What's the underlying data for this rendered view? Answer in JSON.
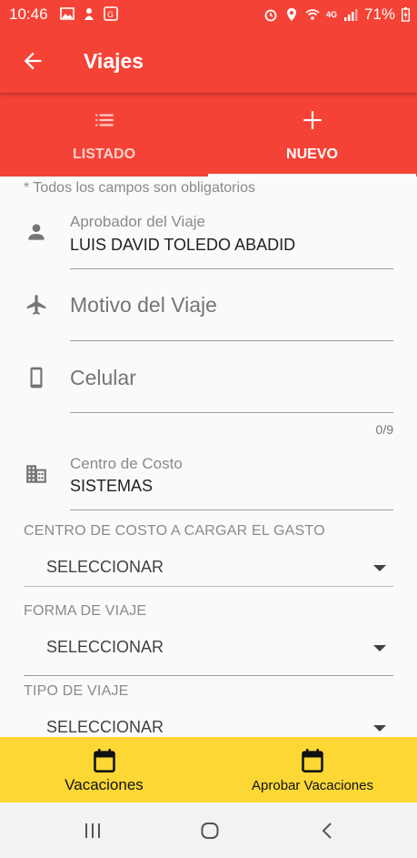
{
  "status_bar": {
    "time": "10:46",
    "battery": "71%",
    "network": "4G"
  },
  "app_bar": {
    "title": "Viajes",
    "back_icon": "arrow-back-icon"
  },
  "tabs": [
    {
      "label": "LISTADO",
      "icon": "list-icon",
      "active": false
    },
    {
      "label": "NUEVO",
      "icon": "plus-icon",
      "active": true
    }
  ],
  "form": {
    "required_note": "* Todos los campos son obligatorios",
    "approver": {
      "label": "Aprobador del Viaje",
      "value": "LUIS DAVID TOLEDO ABADID",
      "icon": "person-icon"
    },
    "reason": {
      "placeholder": "Motivo del Viaje",
      "icon": "airplane-icon"
    },
    "phone": {
      "placeholder": "Celular",
      "icon": "phone-icon",
      "counter": "0/9"
    },
    "cost_center": {
      "label": "Centro de Costo",
      "value": "SISTEMAS",
      "icon": "building-icon"
    },
    "charge_cost_center": {
      "label": "CENTRO DE COSTO A CARGAR EL GASTO",
      "value": "SELECCIONAR"
    },
    "travel_mode": {
      "label": "FORMA DE VIAJE",
      "value": "SELECCIONAR"
    },
    "travel_type": {
      "label": "TIPO DE VIAJE",
      "value": "SELECCIONAR"
    }
  },
  "bottom_nav": [
    {
      "label": "Vacaciones",
      "icon": "calendar-icon"
    },
    {
      "label": "Aprobar Vacaciones",
      "icon": "calendar-icon"
    }
  ],
  "colors": {
    "primary": "#f44336",
    "bottom_bar": "#fdd835"
  }
}
